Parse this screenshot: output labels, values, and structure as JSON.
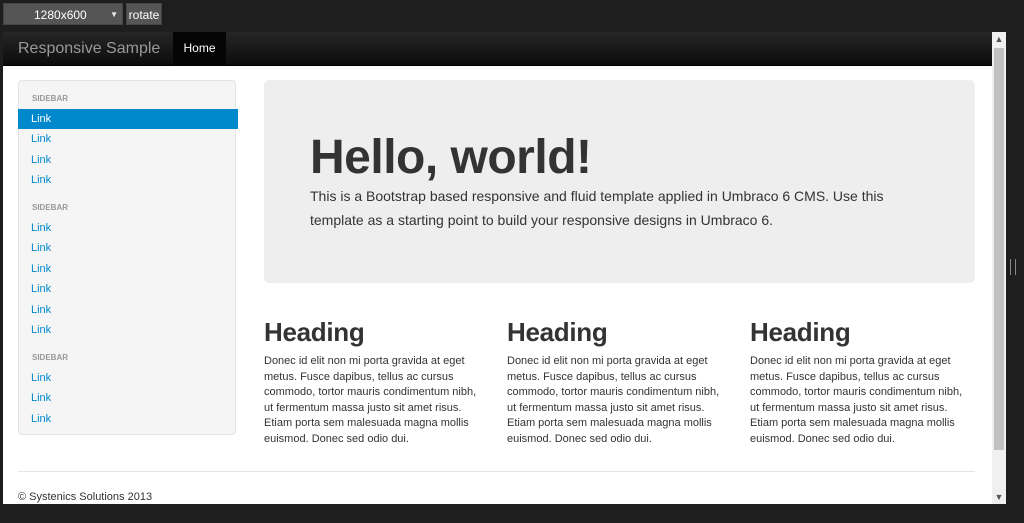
{
  "toolbar": {
    "resolution": "1280x600",
    "rotate_label": "rotate"
  },
  "navbar": {
    "brand": "Responsive Sample",
    "home_label": "Home"
  },
  "sidebar": {
    "groups": [
      {
        "header": "SIDEBAR",
        "links": [
          "Link",
          "Link",
          "Link",
          "Link"
        ]
      },
      {
        "header": "SIDEBAR",
        "links": [
          "Link",
          "Link",
          "Link",
          "Link",
          "Link",
          "Link"
        ]
      },
      {
        "header": "SIDEBAR",
        "links": [
          "Link",
          "Link",
          "Link"
        ]
      }
    ]
  },
  "hero": {
    "title": "Hello, world!",
    "text": "This is a Bootstrap based responsive and fluid template applied in Umbraco 6 CMS. Use this template as a starting point to build your responsive designs in Umbraco 6."
  },
  "columns": [
    {
      "heading": "Heading",
      "text": "Donec id elit non mi porta gravida at eget metus. Fusce dapibus, tellus ac cursus commodo, tortor mauris condimentum nibh, ut fermentum massa justo sit amet risus. Etiam porta sem malesuada magna mollis euismod. Donec sed odio dui."
    },
    {
      "heading": "Heading",
      "text": "Donec id elit non mi porta gravida at eget metus. Fusce dapibus, tellus ac cursus commodo, tortor mauris condimentum nibh, ut fermentum massa justo sit amet risus. Etiam porta sem malesuada magna mollis euismod. Donec sed odio dui."
    },
    {
      "heading": "Heading",
      "text": "Donec id elit non mi porta gravida at eget metus. Fusce dapibus, tellus ac cursus commodo, tortor mauris condimentum nibh, ut fermentum massa justo sit amet risus. Etiam porta sem malesuada magna mollis euismod. Donec sed odio dui."
    }
  ],
  "footer": {
    "text": "© Systenics Solutions 2013"
  },
  "colors": {
    "link": "#0088cc",
    "active_bg": "#0088cc",
    "hero_bg": "#eeeeee",
    "navbar": "#1b1b1b"
  },
  "icons": {
    "select_caret": "caret-down-icon",
    "scroll_up": "arrow-up-icon",
    "scroll_down": "arrow-down-icon"
  }
}
